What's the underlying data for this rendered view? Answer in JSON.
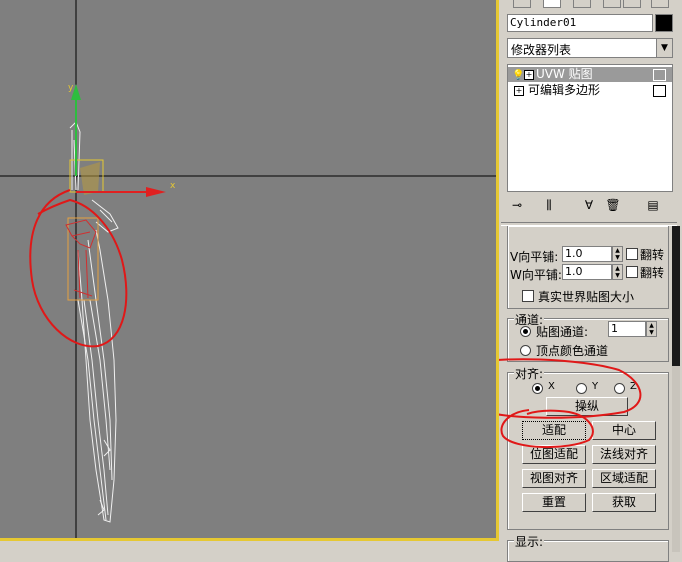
{
  "viewport": {
    "axis_y_label": "y",
    "axis_x_label": "x"
  },
  "panel": {
    "object_name": "Cylinder01",
    "modifier_list": "修改器列表",
    "stack": [
      {
        "label": "UVW 贴图",
        "selected": true
      },
      {
        "label": "可编辑多边形",
        "selected": false
      }
    ],
    "tiling": {
      "v_label": "V向平铺:",
      "v_value": "1.0",
      "w_label": "W向平铺:",
      "w_value": "1.0",
      "flip_label": "翻转",
      "real_world_label": "真实世界贴图大小"
    },
    "channel": {
      "title": "通道:",
      "map_channel_label": "贴图通道:",
      "map_channel_value": "1",
      "vertex_color_label": "顶点颜色通道"
    },
    "alignment": {
      "title": "对齐:",
      "x_label": "X",
      "y_label": "Y",
      "z_label": "Z",
      "manipulate": "操纵",
      "fit": "适配",
      "center": "中心",
      "bitmap_fit": "位图适配",
      "normal_align": "法线对齐",
      "view_align": "视图对齐",
      "region_fit": "区域适配",
      "reset": "重置",
      "acquire": "获取"
    },
    "display": {
      "title": "显示:"
    }
  }
}
